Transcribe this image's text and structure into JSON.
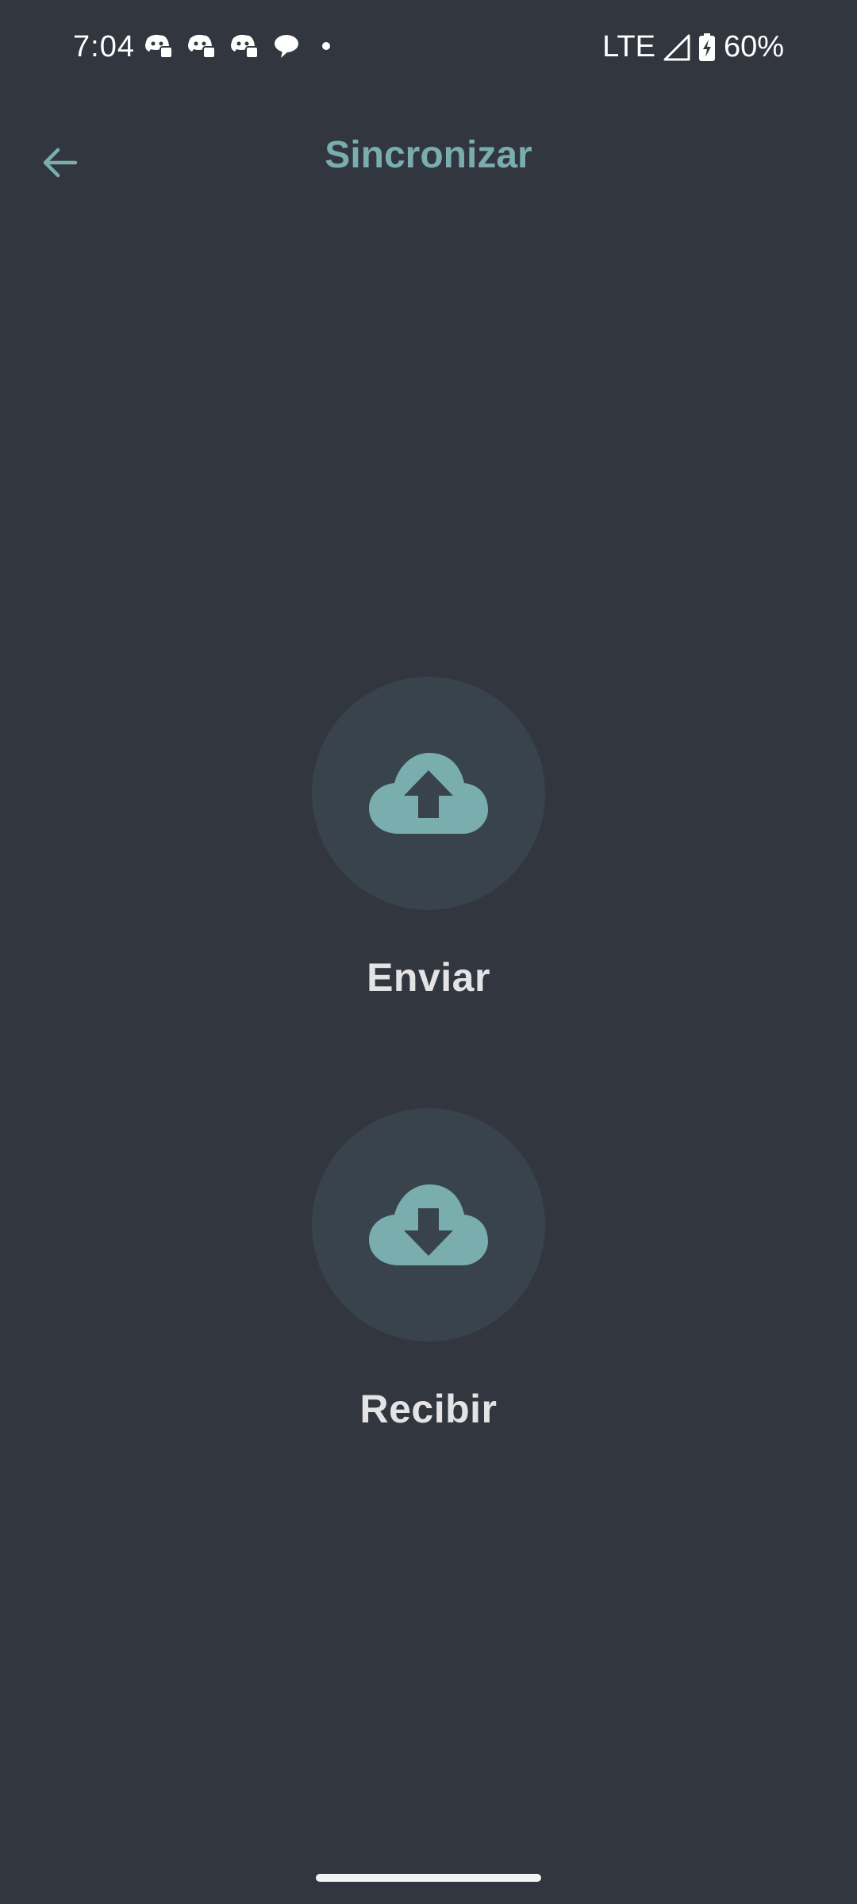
{
  "status_bar": {
    "time": "7:04",
    "notifications": [
      "discord-icon",
      "discord-icon",
      "discord-icon",
      "chat-bubble-icon",
      "dot-icon"
    ],
    "network": "LTE",
    "battery": "60%"
  },
  "app_bar": {
    "title": "Sincronizar",
    "back_icon": "arrow-left-icon"
  },
  "actions": [
    {
      "label": "Enviar",
      "icon": "cloud-upload-icon"
    },
    {
      "label": "Recibir",
      "icon": "cloud-download-icon"
    }
  ],
  "colors": {
    "background": "#32363f",
    "accent": "#7aadae",
    "circle": "#38434c",
    "label": "#e4e4e6"
  }
}
